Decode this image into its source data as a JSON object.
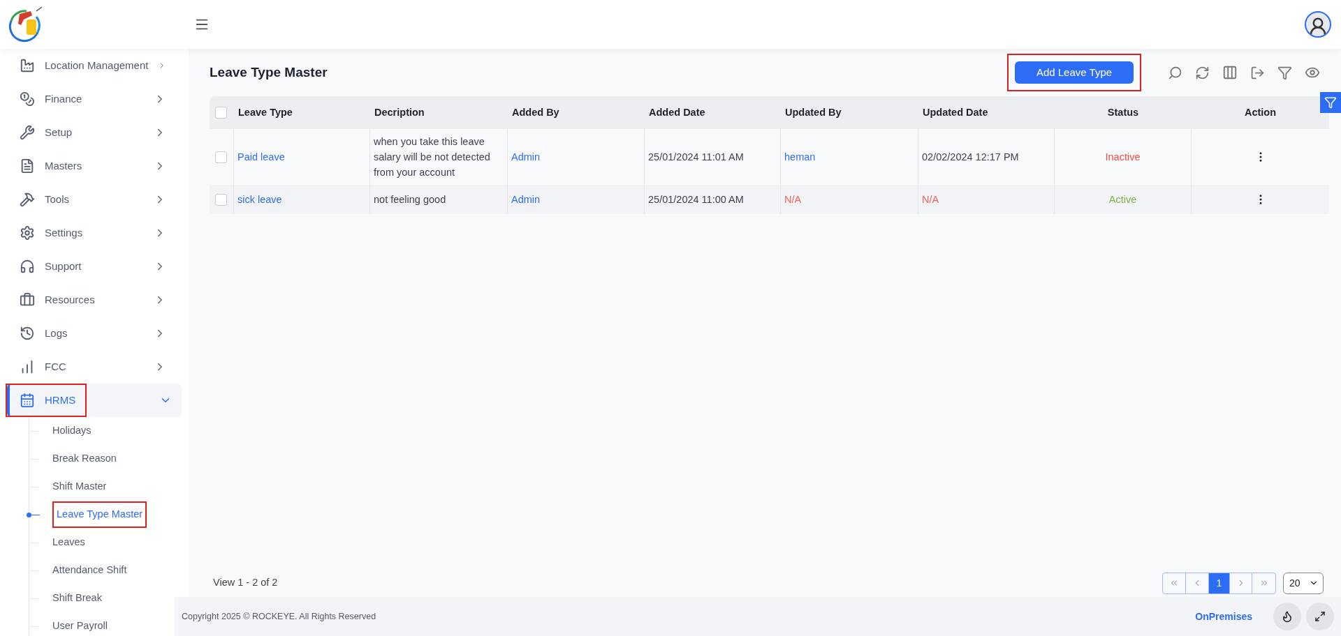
{
  "sidebar": {
    "items": [
      {
        "label": "Location Management",
        "expanded": false,
        "selected": false,
        "highlighted": false
      },
      {
        "label": "Finance",
        "expanded": false,
        "selected": false,
        "highlighted": false
      },
      {
        "label": "Setup",
        "expanded": false,
        "selected": false,
        "highlighted": false
      },
      {
        "label": "Masters",
        "expanded": false,
        "selected": false,
        "highlighted": false
      },
      {
        "label": "Tools",
        "expanded": false,
        "selected": false,
        "highlighted": false
      },
      {
        "label": "Settings",
        "expanded": false,
        "selected": false,
        "highlighted": false
      },
      {
        "label": "Support",
        "expanded": false,
        "selected": false,
        "highlighted": false
      },
      {
        "label": "Resources",
        "expanded": false,
        "selected": false,
        "highlighted": false
      },
      {
        "label": "Logs",
        "expanded": false,
        "selected": false,
        "highlighted": false
      },
      {
        "label": "FCC",
        "expanded": false,
        "selected": false,
        "highlighted": false
      },
      {
        "label": "HRMS",
        "expanded": true,
        "selected": true,
        "highlighted": true,
        "children": [
          {
            "label": "Holidays",
            "selected": false,
            "highlighted": false
          },
          {
            "label": "Break Reason",
            "selected": false,
            "highlighted": false
          },
          {
            "label": "Shift Master",
            "selected": false,
            "highlighted": false
          },
          {
            "label": "Leave Type Master",
            "selected": true,
            "highlighted": true
          },
          {
            "label": "Leaves",
            "selected": false,
            "highlighted": false
          },
          {
            "label": "Attendance Shift",
            "selected": false,
            "highlighted": false
          },
          {
            "label": "Shift Break",
            "selected": false,
            "highlighted": false
          },
          {
            "label": "User Payroll",
            "selected": false,
            "highlighted": false
          }
        ]
      }
    ]
  },
  "page": {
    "title": "Leave Type Master",
    "add_button": {
      "label": "Add Leave Type",
      "highlighted": true
    }
  },
  "table": {
    "select_all": {
      "checked": false
    },
    "columns": [
      "Leave Type",
      "Decription",
      "Added By",
      "Added Date",
      "Updated By",
      "Updated Date",
      "Status",
      "Action"
    ],
    "rows": [
      {
        "checked": false,
        "cells": [
          {
            "text": "Paid leave",
            "kind": "link"
          },
          {
            "text": "when you take this leave salary will be not detected from your account",
            "kind": "text"
          },
          {
            "text": "Admin",
            "kind": "link"
          },
          {
            "text": "25/01/2024 11:01 AM",
            "kind": "text"
          },
          {
            "text": "heman",
            "kind": "link"
          },
          {
            "text": "02/02/2024 12:17 PM",
            "kind": "text"
          },
          {
            "text": "Inactive",
            "kind": "inactive"
          }
        ]
      },
      {
        "checked": false,
        "cells": [
          {
            "text": "sick leave",
            "kind": "link"
          },
          {
            "text": "not feeling good",
            "kind": "text"
          },
          {
            "text": "Admin",
            "kind": "link"
          },
          {
            "text": "25/01/2024 11:00 AM",
            "kind": "text"
          },
          {
            "text": "N/A",
            "kind": "missing"
          },
          {
            "text": "N/A",
            "kind": "missing"
          },
          {
            "text": "Active",
            "kind": "active"
          }
        ]
      }
    ]
  },
  "pagination": {
    "summary": "View 1 - 2 of 2",
    "pages": [
      {
        "label": "1",
        "selected": true
      }
    ],
    "page_size": "20"
  },
  "footer": {
    "copyright": "Copyright 2025 © ROCKEYE. All Rights Reserved",
    "mode": "OnPremises"
  }
}
